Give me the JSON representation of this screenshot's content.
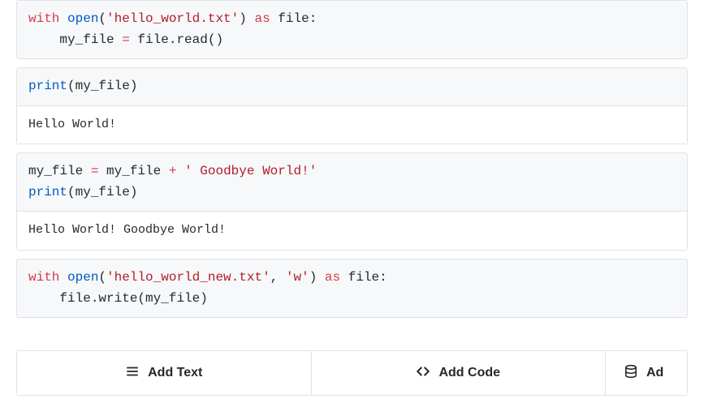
{
  "cells": [
    {
      "code_html": "<span class='tok-keyword'>with</span> <span class='tok-builtin'>open</span><span class='tok-paren'>(</span><span class='tok-string'>'hello_world.txt'</span><span class='tok-paren'>)</span> <span class='tok-keyword'>as</span> <span class='tok-name'>file</span>:\n    my_file <span class='tok-op'>=</span> file.read<span class='tok-paren'>()</span>",
      "output": ""
    },
    {
      "code_html": "<span class='tok-builtin'>print</span><span class='tok-paren'>(</span>my_file<span class='tok-paren'>)</span>",
      "output": "Hello World!"
    },
    {
      "code_html": "my_file <span class='tok-op'>=</span> my_file <span class='tok-op'>+</span> <span class='tok-string'>' Goodbye World!'</span>\n<span class='tok-builtin'>print</span><span class='tok-paren'>(</span>my_file<span class='tok-paren'>)</span>",
      "output": "Hello World! Goodbye World!"
    },
    {
      "code_html": "<span class='tok-keyword'>with</span> <span class='tok-builtin'>open</span><span class='tok-paren'>(</span><span class='tok-string'>'hello_world_new.txt'</span>, <span class='tok-string'>'w'</span><span class='tok-paren'>)</span> <span class='tok-keyword'>as</span> <span class='tok-name'>file</span>:\n    file.write<span class='tok-paren'>(</span>my_file<span class='tok-paren'>)</span>",
      "output": ""
    }
  ],
  "toolbar": {
    "add_text": "Add Text",
    "add_code": "Add Code",
    "add_partial": "Ad"
  }
}
